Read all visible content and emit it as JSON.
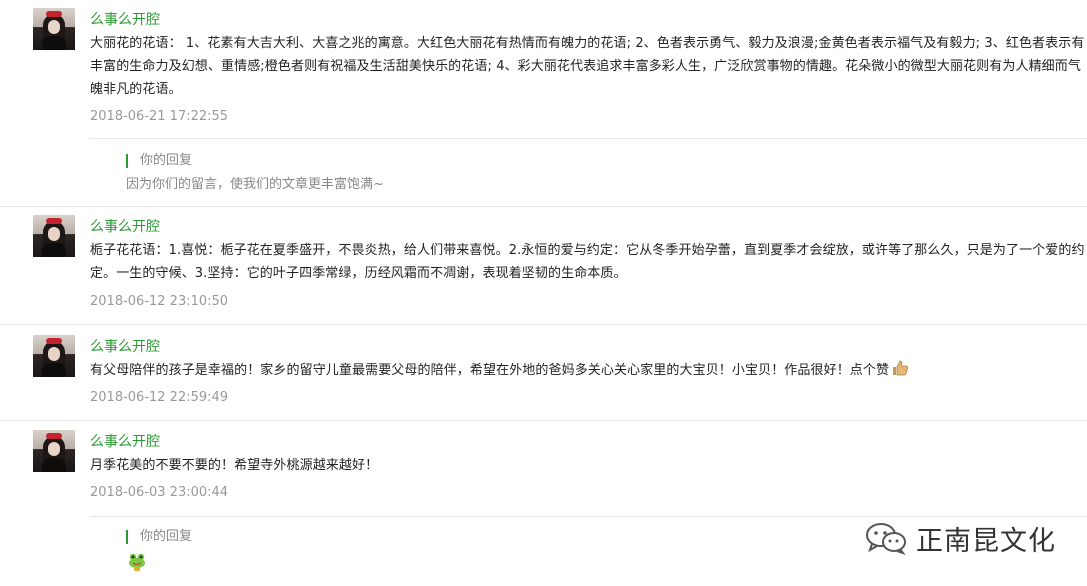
{
  "comments": [
    {
      "nickname": "么事么开腔",
      "text": "大丽花的花语： 1、花素有大吉大利、大喜之兆的寓意。大红色大丽花有热情而有魄力的花语; 2、色者表示勇气、毅力及浪漫;金黄色者表示福气及有毅力; 3、红色者表示有丰富的生命力及幻想、重情感;橙色者则有祝福及生活甜美快乐的花语; 4、彩大丽花代表追求丰富多彩人生，广泛欣赏事物的情趣。花朵微小的微型大丽花则有为人精细而气魄非凡的花语。",
      "time": "2018-06-21 17:22:55",
      "reply": {
        "label": "你的回复",
        "text": "因为你们的留言，使我们的文章更丰富饱满~"
      }
    },
    {
      "nickname": "么事么开腔",
      "text": "栀子花花语：1.喜悦：栀子花在夏季盛开，不畏炎热，给人们带来喜悦。2.永恒的爱与约定：它从冬季开始孕蕾，直到夏季才会绽放，或许等了那么久，只是为了一个爱的约定。一生的守候、3.坚持：它的叶子四季常绿，历经风霜而不凋谢，表现着坚韧的生命本质。",
      "time": "2018-06-12 23:10:50"
    },
    {
      "nickname": "么事么开腔",
      "text": "有父母陪伴的孩子是幸福的！家乡的留守儿童最需要父母的陪伴，希望在外地的爸妈多关心关心家里的大宝贝！小宝贝！作品很好！点个赞",
      "emoji": "thumbs-up-icon",
      "time": "2018-06-12 22:59:49"
    },
    {
      "nickname": "么事么开腔",
      "text": "月季花美的不要不要的！希望寺外桃源越来越好！",
      "time": "2018-06-03 23:00:44",
      "reply": {
        "label": "你的回复",
        "emoji": "frog-emoji-icon"
      }
    }
  ],
  "watermark": {
    "icon": "wechat-logo-icon",
    "text": "正南昆文化"
  },
  "colors": {
    "accent": "#2c9a33",
    "muted": "#999999",
    "divider": "#e6e6e6"
  }
}
